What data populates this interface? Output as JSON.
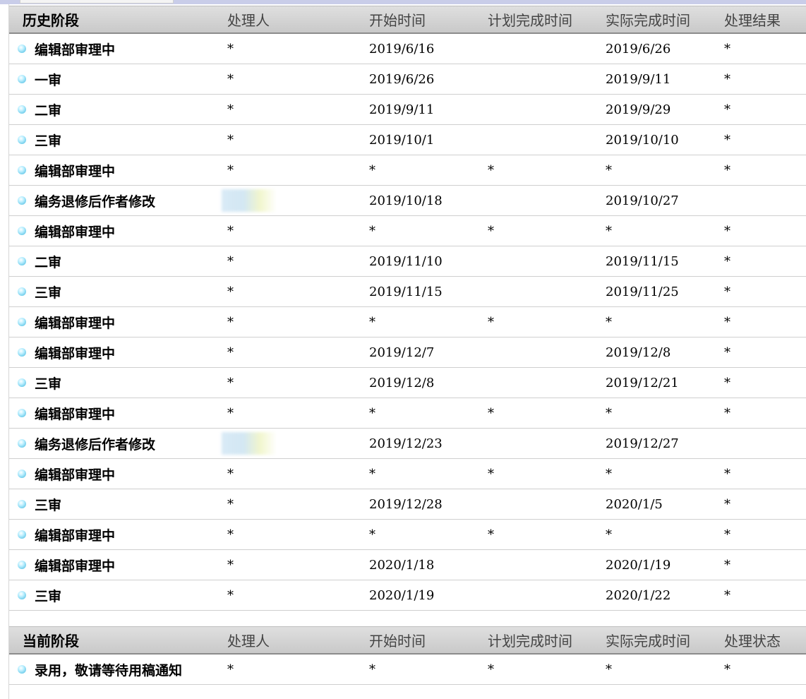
{
  "history": {
    "headers": [
      "历史阶段",
      "处理人",
      "开始时间",
      "计划完成时间",
      "实际完成时间",
      "处理结果"
    ],
    "rows": [
      {
        "stage": "编辑部审理中",
        "handler": "*",
        "start": "2019/6/16",
        "planned": "",
        "actual": "2019/6/26",
        "result": "*"
      },
      {
        "stage": "一审",
        "handler": "*",
        "start": "2019/6/26",
        "planned": "",
        "actual": "2019/9/11",
        "result": "*"
      },
      {
        "stage": "二审",
        "handler": "*",
        "start": "2019/9/11",
        "planned": "",
        "actual": "2019/9/29",
        "result": "*"
      },
      {
        "stage": "三审",
        "handler": "*",
        "start": "2019/10/1",
        "planned": "",
        "actual": "2019/10/10",
        "result": "*"
      },
      {
        "stage": "编辑部审理中",
        "handler": "*",
        "start": "*",
        "planned": "*",
        "actual": "*",
        "result": "*"
      },
      {
        "stage": "编务退修后作者修改",
        "handler": "",
        "start": "2019/10/18",
        "planned": "",
        "actual": "2019/10/27",
        "result": "",
        "blurred_handler": true
      },
      {
        "stage": "编辑部审理中",
        "handler": "*",
        "start": "*",
        "planned": "*",
        "actual": "*",
        "result": "*"
      },
      {
        "stage": "二审",
        "handler": "*",
        "start": "2019/11/10",
        "planned": "",
        "actual": "2019/11/15",
        "result": "*"
      },
      {
        "stage": "三审",
        "handler": "*",
        "start": "2019/11/15",
        "planned": "",
        "actual": "2019/11/25",
        "result": "*"
      },
      {
        "stage": "编辑部审理中",
        "handler": "*",
        "start": "*",
        "planned": "*",
        "actual": "*",
        "result": "*"
      },
      {
        "stage": "编辑部审理中",
        "handler": "*",
        "start": "2019/12/7",
        "planned": "",
        "actual": "2019/12/8",
        "result": "*"
      },
      {
        "stage": "三审",
        "handler": "*",
        "start": "2019/12/8",
        "planned": "",
        "actual": "2019/12/21",
        "result": "*"
      },
      {
        "stage": "编辑部审理中",
        "handler": "*",
        "start": "*",
        "planned": "*",
        "actual": "*",
        "result": "*"
      },
      {
        "stage": "编务退修后作者修改",
        "handler": "",
        "start": "2019/12/23",
        "planned": "",
        "actual": "2019/12/27",
        "result": "",
        "blurred_handler": true
      },
      {
        "stage": "编辑部审理中",
        "handler": "*",
        "start": "*",
        "planned": "*",
        "actual": "*",
        "result": "*"
      },
      {
        "stage": "三审",
        "handler": "*",
        "start": "2019/12/28",
        "planned": "",
        "actual": "2020/1/5",
        "result": "*"
      },
      {
        "stage": "编辑部审理中",
        "handler": "*",
        "start": "*",
        "planned": "*",
        "actual": "*",
        "result": "*"
      },
      {
        "stage": "编辑部审理中",
        "handler": "*",
        "start": "2020/1/18",
        "planned": "",
        "actual": "2020/1/19",
        "result": "*"
      },
      {
        "stage": "三审",
        "handler": "*",
        "start": "2020/1/19",
        "planned": "",
        "actual": "2020/1/22",
        "result": "*"
      }
    ]
  },
  "current": {
    "headers": [
      "当前阶段",
      "处理人",
      "开始时间",
      "计划完成时间",
      "实际完成时间",
      "处理状态"
    ],
    "rows": [
      {
        "stage": "录用，敬请等待用稿通知",
        "handler": "*",
        "start": "*",
        "planned": "*",
        "actual": "*",
        "result": "*"
      }
    ]
  },
  "icons": {
    "row_bullet": "bullet-circle-icon"
  },
  "colors": {
    "header_bg": "#d4d4d4",
    "bullet": "#3fb7de",
    "top_strip": "#c9cde9"
  }
}
